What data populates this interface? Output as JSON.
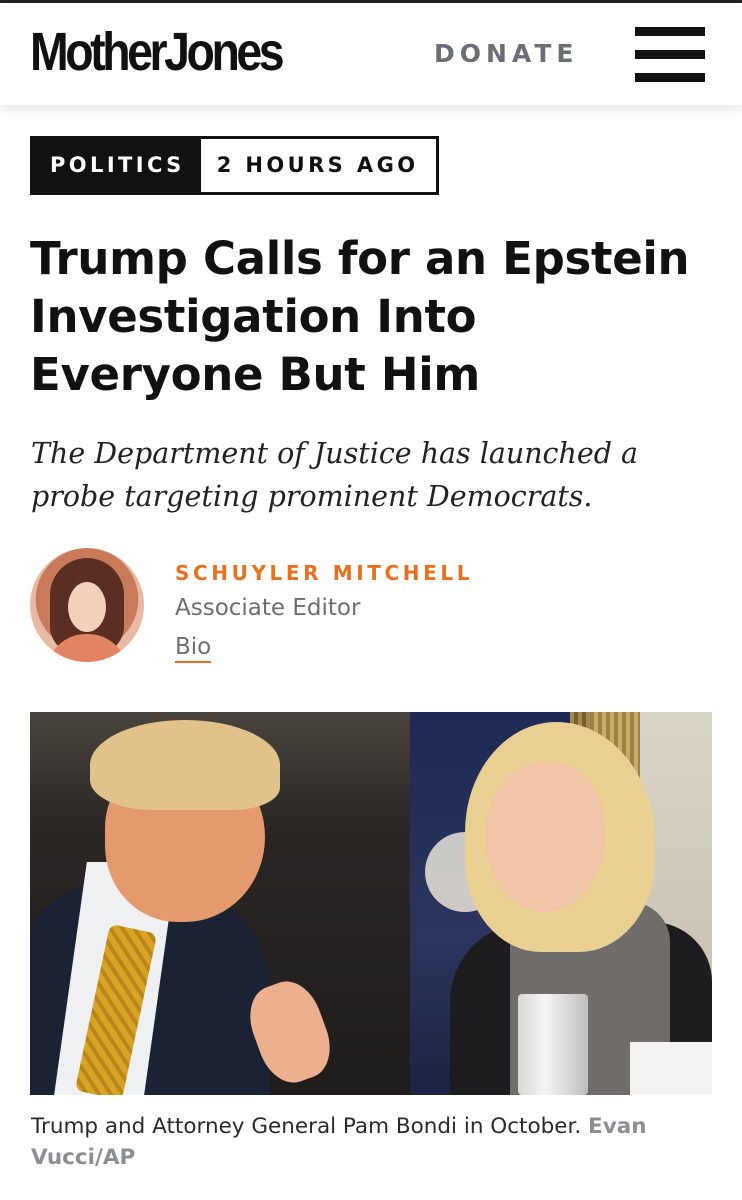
{
  "header": {
    "logo": "MotherJones",
    "donate_label": "DONATE",
    "menu_icon": "hamburger-menu-icon"
  },
  "tags": {
    "section": "POLITICS",
    "time": "2 HOURS AGO"
  },
  "article": {
    "headline": "Trump Calls for an Epstein Investigation Into Everyone But Him",
    "dek": "The Department of Justice has launched a probe targeting prominent Democrats."
  },
  "author": {
    "name": "SCHUYLER MITCHELL",
    "role": "Associate Editor",
    "bio_link": "Bio"
  },
  "photo": {
    "caption": "Trump and Attorney General Pam Bondi in October.",
    "credit": "Evan Vucci/AP"
  },
  "colors": {
    "accent": "#e8711f",
    "text": "#111111",
    "muted": "#6e6e6e",
    "donate": "#6b6e75"
  }
}
